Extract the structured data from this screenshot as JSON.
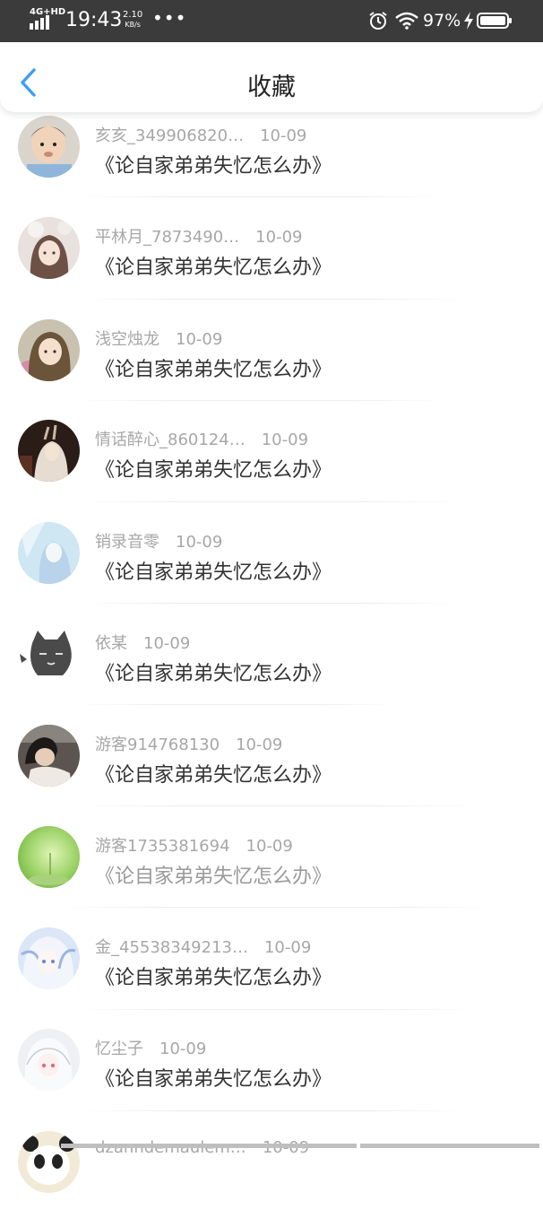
{
  "status_bar": {
    "network": "4G+HD",
    "time": "19:43",
    "speed_value": "2.10",
    "speed_unit": "KB/s",
    "more": "•••",
    "battery": "97%"
  },
  "header": {
    "title": "收藏",
    "back_icon": "chevron-left-icon"
  },
  "colors": {
    "accent": "#3a9ff5",
    "status_bar_bg": "#3b3b3b",
    "meta_text": "#a7a7a7",
    "title_text": "#333333"
  },
  "items": [
    {
      "user": "亥亥_349906820…",
      "date": "10-09",
      "title": "《论自家弟弟失忆怎么办》",
      "avatar": "baby-photo"
    },
    {
      "user": "平林月_7873490…",
      "date": "10-09",
      "title": "《论自家弟弟失忆怎么办》",
      "avatar": "anime-girl-flowers"
    },
    {
      "user": "浅空烛龙",
      "date": "10-09",
      "title": "《论自家弟弟失忆怎么办》",
      "avatar": "anime-girl-brown-hair"
    },
    {
      "user": "情话醉心_860124…",
      "date": "10-09",
      "title": "《论自家弟弟失忆怎么办》",
      "avatar": "dark-fantasy-art"
    },
    {
      "user": "销录音零",
      "date": "10-09",
      "title": "《论自家弟弟失忆怎么办》",
      "avatar": "anime-blue-pastel"
    },
    {
      "user": "依某",
      "date": "10-09",
      "title": "《论自家弟弟失忆怎么办》",
      "avatar": "cartoon-cat"
    },
    {
      "user": "游客914768130",
      "date": "10-09",
      "title": "《论自家弟弟失忆怎么办》",
      "avatar": "boy-photo"
    },
    {
      "user": "游客1735381694",
      "date": "10-09",
      "title": "《论自家弟弟失忆怎么办》",
      "avatar": "green-nature"
    },
    {
      "user": "金_45538349213…",
      "date": "10-09",
      "title": "《论自家弟弟失忆怎么办》",
      "avatar": "anime-white-hair-blue"
    },
    {
      "user": "忆尘子",
      "date": "10-09",
      "title": "《论自家弟弟失忆怎么办》",
      "avatar": "anime-white-hair-girl"
    },
    {
      "user": "dzanndemaulem…",
      "date": "10-09",
      "title": "",
      "avatar": "panda"
    }
  ]
}
